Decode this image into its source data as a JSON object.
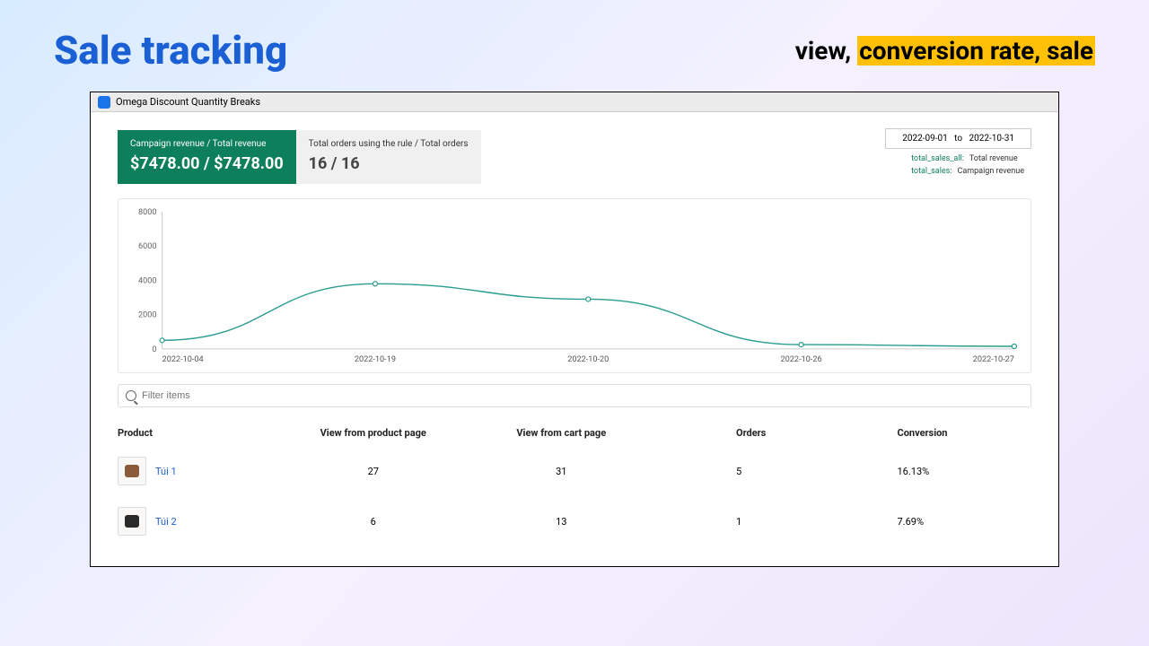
{
  "header": {
    "title": "Sale tracking",
    "subtitle_prefix": "view, ",
    "subtitle_highlight": "conversion rate, sale"
  },
  "app": {
    "name": "Omega Discount Quantity Breaks"
  },
  "stats": {
    "revenue_label": "Campaign revenue / Total revenue",
    "revenue_value": "$7478.00 / $7478.00",
    "orders_label": "Total orders using the rule / Total orders",
    "orders_value": "16 / 16"
  },
  "date_range": {
    "from": "2022-09-01",
    "sep": "to",
    "to": "2022-10-31"
  },
  "legend": {
    "items": [
      {
        "k": "total_sales_all:",
        "v": "Total revenue"
      },
      {
        "k": "total_sales:",
        "v": "Campaign revenue"
      }
    ]
  },
  "chart_data": {
    "type": "line",
    "xlabel": "",
    "ylabel": "",
    "ylim": [
      0,
      8000
    ],
    "yticks": [
      8000,
      6000,
      4000,
      2000,
      0
    ],
    "categories": [
      "2022-10-04",
      "2022-10-19",
      "2022-10-20",
      "2022-10-26",
      "2022-10-27"
    ],
    "series": [
      {
        "name": "total_sales_all",
        "values": [
          500,
          3800,
          2900,
          250,
          150
        ]
      },
      {
        "name": "total_sales",
        "values": [
          500,
          3800,
          2900,
          250,
          150
        ]
      }
    ],
    "color": "#2a9d8f"
  },
  "filter": {
    "placeholder": "Filter items"
  },
  "table": {
    "headers": [
      "Product",
      "View from product page",
      "View from cart page",
      "Orders",
      "Conversion"
    ],
    "rows": [
      {
        "name": "Túi 1",
        "view_product": "27",
        "view_cart": "31",
        "orders": "5",
        "conversion": "16.13%",
        "thumb_color": "#8b5a3a"
      },
      {
        "name": "Túi 2",
        "view_product": "6",
        "view_cart": "13",
        "orders": "1",
        "conversion": "7.69%",
        "thumb_color": "#2a2a2a"
      }
    ]
  }
}
